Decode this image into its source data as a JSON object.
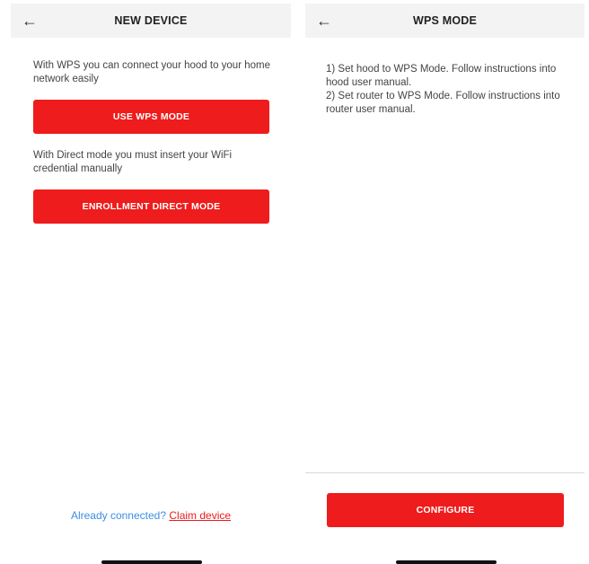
{
  "new_device": {
    "title": "NEW DEVICE",
    "back_icon": "back-arrow-icon",
    "wps_text": "With WPS you can connect your hood to your home network easily",
    "wps_button": "USE WPS MODE",
    "direct_text": "With Direct mode you must insert your WiFi credential manually",
    "direct_button": "ENROLLMENT DIRECT MODE",
    "already_connected": "Already connected?",
    "claim_device": "Claim device"
  },
  "wps_mode": {
    "title": "WPS MODE",
    "back_icon": "back-arrow-icon",
    "step1": "1) Set hood to WPS Mode. Follow instructions into hood user manual.",
    "step2": "2) Set router to WPS Mode. Follow instructions into router user manual.",
    "configure_button": "CONFIGURE"
  },
  "colors": {
    "accent": "#ee1c1c",
    "link": "#3b8fe6",
    "header_bg": "#f3f3f3"
  }
}
